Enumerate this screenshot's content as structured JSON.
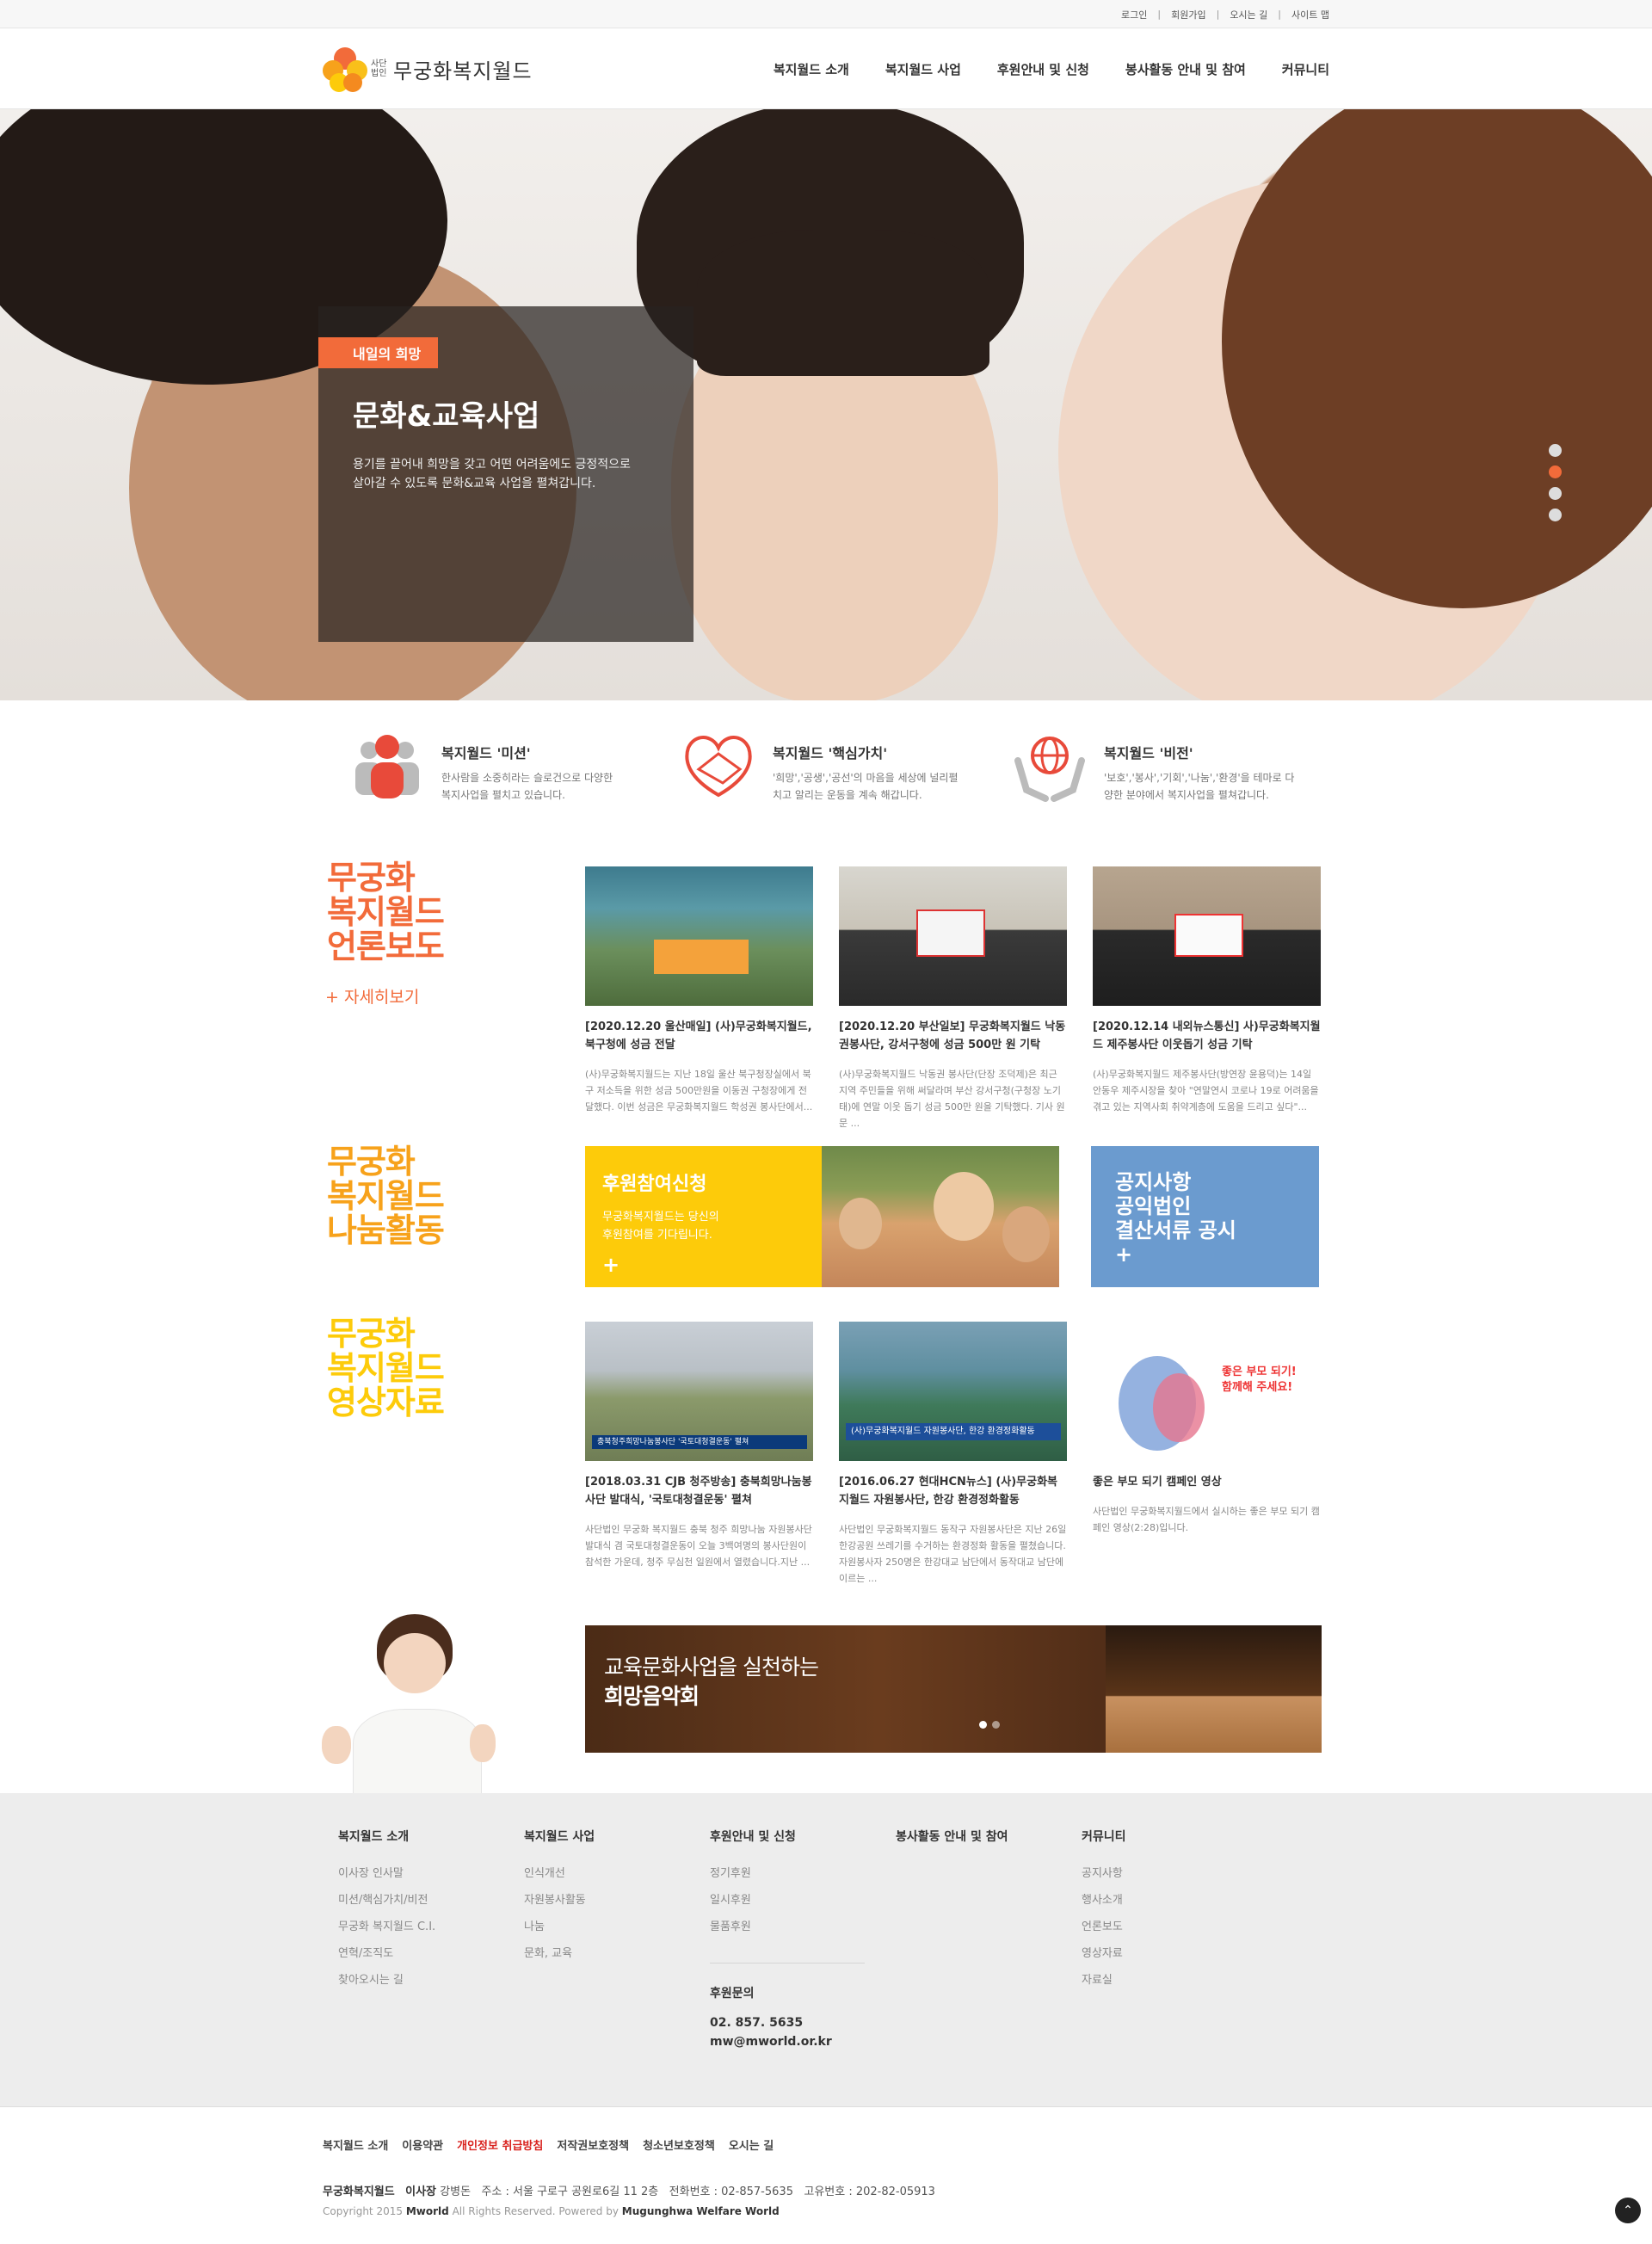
{
  "util": {
    "login": "로그인",
    "join": "회원가입",
    "directions": "오시는 길",
    "sitemap": "사이트 맵"
  },
  "logo": {
    "small": "사단 법인",
    "name": "무궁화복지월드"
  },
  "gnb": [
    "복지월드 소개",
    "복지월드 사업",
    "후원안내 및 신청",
    "봉사활동 안내 및 참여",
    "커뮤니티"
  ],
  "hero": {
    "tag": "내일의 희망",
    "title": "문화&교육사업",
    "desc1": "용기를 끝어내 희망을 갖고 어떤 어려움에도 긍정적으로",
    "desc2": "살아갈 수 있도록 문화&교육 사업을 펼쳐갑니다.",
    "active_slide": 2,
    "slide_count": 4
  },
  "values": [
    {
      "title": "복지월드 '미션'",
      "desc1": "한사람을 소중히라는 슬로건으로 다양한",
      "desc2": "복지사업을 펼치고 있습니다.",
      "icon": "people-icon"
    },
    {
      "title": "복지월드 '핵심가치'",
      "desc1": "'희망','공생','공선'의 마음을 세상에 널리펼",
      "desc2": "치고 알리는 운동을 계속 해갑니다.",
      "icon": "handshake-icon"
    },
    {
      "title": "복지월드 '비전'",
      "desc1": "'보호','봉사','기회','나눔','환경'을 테마로 다",
      "desc2": "양한 분야에서 복지사업을 펼쳐갑니다.",
      "icon": "globe-hands-icon"
    }
  ],
  "press": {
    "title1": "무궁화",
    "title2": "복지월드",
    "title3": "언론보도",
    "more": "+ 자세히보기",
    "items": [
      {
        "title": "[2020.12.20 울산매일] (사)무궁화복지월드, 북구청에 성금 전달",
        "desc": "(사)무궁화복지월드는 지난 18일 울산 북구청장실에서 북구 저소득을 위한 성금 500만원을 이동권 구청장에게 전달했다. 이번 성금은 무궁화복지월드 학성권 봉사단에서..."
      },
      {
        "title": "[2020.12.20 부산일보] 무궁화복지월드 낙동권봉사단, 강서구청에 성금 500만 원 기탁",
        "desc": "(사)무궁화복지월드 낙동권 봉사단(단장 조덕제)은 최근 지역 주민들을 위해 써달라며 부산 강서구청(구청장 노기태)에 연말 이웃 돕기 성금 500만 원을 기탁했다. 기사 원문 ..."
      },
      {
        "title": "[2020.12.14 내외뉴스통신] 사)무궁화복지월드 제주봉사단 이웃돕기 성금 기탁",
        "desc": "(사)무궁화복지월드 제주봉사단(방연장 윤용덕)는 14일 안동우 제주시장을 찾아 \"연말연시 코로나 19로 어려움을 겪고 있는 지역사회 취약계층에 도움을 드리고 싶다\"..."
      }
    ]
  },
  "share": {
    "title1": "무궁화",
    "title2": "복지월드",
    "title3": "나눔활동",
    "donate_title": "후원참여신청",
    "donate_desc1": "무궁화복지월드는 당신의",
    "donate_desc2": "후원참여를 기다립니다.",
    "plus": "+",
    "notice1": "공지사항",
    "notice2": "공익법인",
    "notice3": "결산서류 공시"
  },
  "video": {
    "title1": "무궁화",
    "title2": "복지월드",
    "title3": "영상자료",
    "items": [
      {
        "title": "[2018.03.31 CJB 청주방송] 충북희망나눔봉사단 발대식, '국토대청결운동' 펼쳐",
        "desc": "사단법인 무궁화 복지월드 충북 청주 희망나눔 자원봉사단 발대식 겸 국토대청결운동이 오늘 3백여명의 봉사단원이 참석한 가운데, 청주 무심천 일원에서 열렸습니다.지난 ...",
        "caption": "충북청주희망나눔봉사단 '국토대청결운동' 펼쳐"
      },
      {
        "title": "[2016.06.27 현대HCN뉴스] (사)무궁화복지월드 자원봉사단, 한강 환경정화활동",
        "desc": "사단법인 무궁화복지월드 동작구 자원봉사단은 지난 26일 한강공원 쓰레기를 수거하는 환경정화 활동을 펼쳤습니다. 자원봉사자 250명은 한강대교 남단에서 동작대교 남단에 이르는 ...",
        "caption": "(사)무궁화복지월드 자원봉사단, 한강 환경정화활동"
      },
      {
        "title": "좋은 부모 되기 캠페인 영상",
        "desc": "사단법인 무궁화복지월드에서 실시하는 좋은 부모 되기 캠페인 영상(2:28)입니다.",
        "caption": "좋은 부모 되기! 함께해 주세요!"
      }
    ]
  },
  "banner": {
    "line1": "교육문화사업을 실천하는",
    "line2": "희망음악회"
  },
  "footer_nav": [
    {
      "head": "복지월드 소개",
      "items": [
        "이사장 인사말",
        "미션/핵심가치/비전",
        "무궁화 복지월드 C.I.",
        "연혁/조직도",
        "찾아오시는 길"
      ]
    },
    {
      "head": "복지월드 사업",
      "items": [
        "인식개선",
        "자원봉사활동",
        "나눔",
        "문화, 교육"
      ]
    },
    {
      "head": "후원안내 및 신청",
      "items": [
        "정기후원",
        "일시후원",
        "물품후원"
      ]
    },
    {
      "head": "봉사활동 안내 및 참여",
      "items": []
    },
    {
      "head": "커뮤니티",
      "items": [
        "공지사항",
        "행사소개",
        "언론보도",
        "영상자료",
        "자료실"
      ]
    }
  ],
  "support": {
    "head": "후원문의",
    "phone": "02. 857. 5635",
    "email": "mw@mworld.or.kr"
  },
  "footer_links": [
    "복지월드 소개",
    "이용약관",
    "개인정보 취급방침",
    "저작권보호정책",
    "청소년보호정책",
    "오시는 길"
  ],
  "footer_info": {
    "org": "무궁화복지월드",
    "ceo_label": "이사장",
    "ceo": "강병돈",
    "addr": "주소 : 서울 구로구 공원로6길 11 2층",
    "tel": "전화번호 : 02-857-5635",
    "biz": "고유번호 : 202-82-05913"
  },
  "copyright": {
    "pre": "Copyright 2015",
    "brand": "Mworld",
    "mid": "All Rights Reserved. Powered by",
    "power": "Mugunghwa Welfare World"
  },
  "colors": {
    "accent": "#f26b3a",
    "yellow": "#fdcb0a",
    "blue": "#6b9bcf",
    "red": "#d9231f"
  }
}
